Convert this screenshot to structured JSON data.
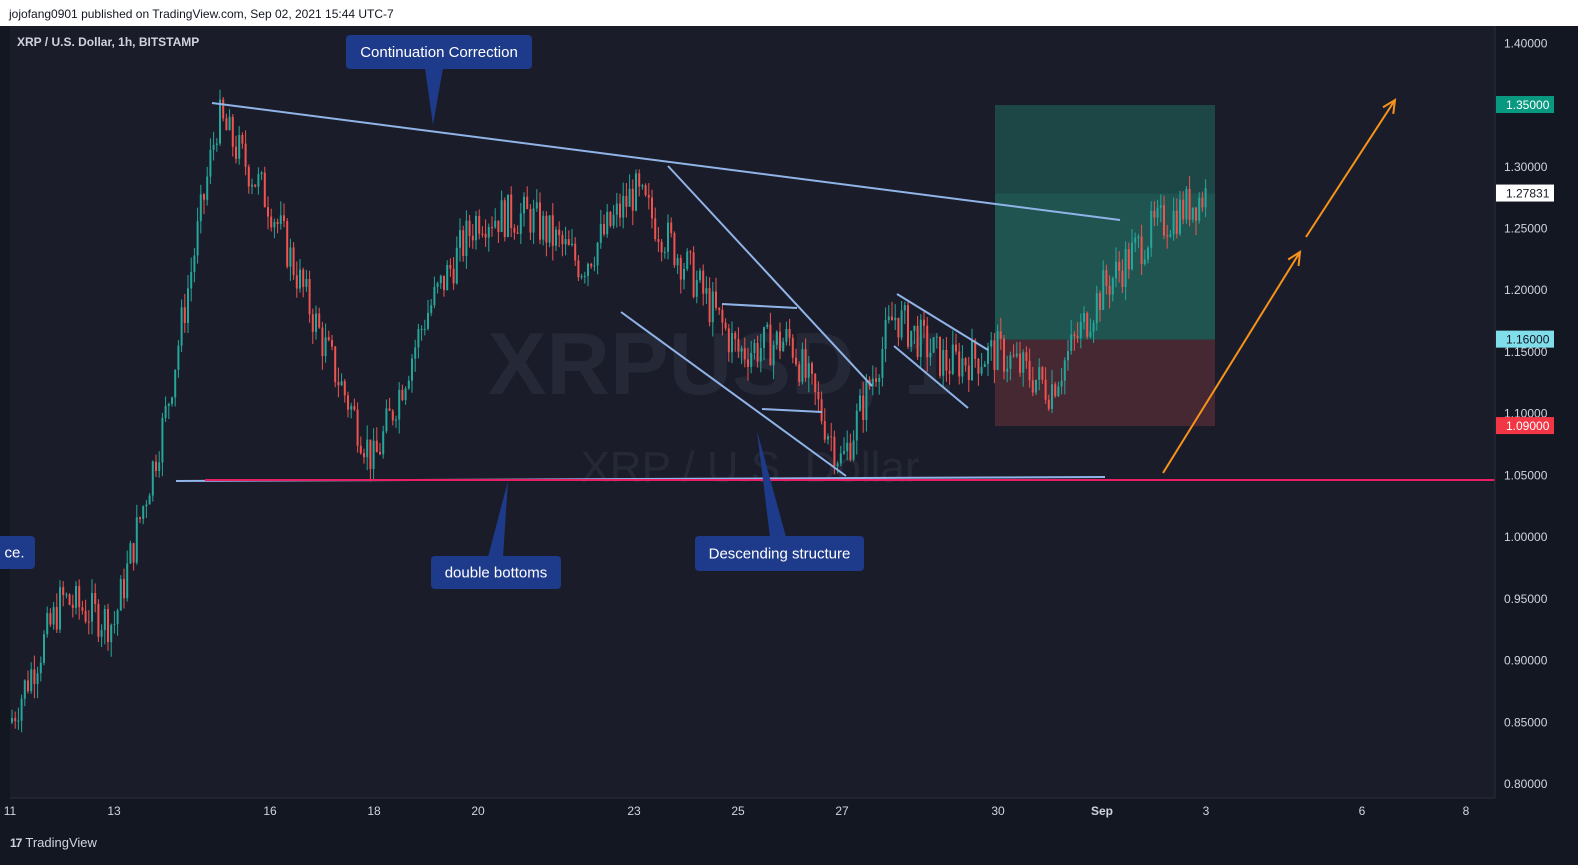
{
  "header": {
    "publisher": "jojofang0901 published on TradingView.com, Sep 02, 2021 15:44 UTC-7"
  },
  "symbol_title": "XRP / U.S. Dollar, 1h, BITSTAMP",
  "watermark": {
    "ticker": "XRPUSD, 1",
    "name": "XRP / U.S. Dollar"
  },
  "footer": {
    "brand": "TradingView",
    "logo_icon": "tradingview-logo-icon"
  },
  "colors": {
    "background": "#131722",
    "pane": "#1b1e2b",
    "up": "#26a69a",
    "down": "#ef5350",
    "trendline": "#90b4e8",
    "support": "#e91e63",
    "arrow": "#f7931a",
    "note_bg": "#1e3a8a",
    "target_zone": "#1f4d4b",
    "stop_zone": "#4a2a33"
  },
  "annotations": [
    {
      "id": "continuation-correction",
      "text": "Continuation Correction"
    },
    {
      "id": "double-bottoms",
      "text": "double bottoms"
    },
    {
      "id": "descending-structure",
      "text": "Descending structure"
    },
    {
      "id": "cut-note",
      "text": "ce."
    }
  ],
  "price_badges": [
    {
      "id": "target",
      "text": "1.35000",
      "bg": "#089981",
      "fg": "#ffffff"
    },
    {
      "id": "last",
      "text": "1.27831",
      "bg": "#ffffff",
      "fg": "#131722"
    },
    {
      "id": "entry",
      "text": "1.16000",
      "bg": "#80deea",
      "fg": "#131722"
    },
    {
      "id": "stop",
      "text": "1.09000",
      "bg": "#f23645",
      "fg": "#ffffff"
    }
  ],
  "chart_data": {
    "type": "candlestick",
    "title": "XRP / U.S. Dollar, 1h, BITSTAMP",
    "ylim": [
      0.8,
      1.4
    ],
    "yticks": [
      "1.40000",
      "1.35000",
      "1.30000",
      "1.25000",
      "1.20000",
      "1.15000",
      "1.10000",
      "1.05000",
      "1.00000",
      "0.95000",
      "0.90000",
      "0.85000",
      "0.80000"
    ],
    "xticks": [
      "11",
      "13",
      "16",
      "18",
      "20",
      "23",
      "25",
      "27",
      "30",
      "Sep",
      "3",
      "6",
      "8"
    ],
    "support_level": 1.05,
    "position": {
      "target": 1.35,
      "entry": 1.16,
      "stop": 1.09
    },
    "last_price": 1.27831,
    "price_path": [
      {
        "x": "11",
        "y": 0.85
      },
      {
        "x": "12",
        "y": 0.95
      },
      {
        "x": "13",
        "y": 0.93
      },
      {
        "x": "14",
        "y": 1.1
      },
      {
        "x": "15",
        "y": 1.34
      },
      {
        "x": "16",
        "y": 1.27
      },
      {
        "x": "17",
        "y": 1.16
      },
      {
        "x": "18",
        "y": 1.06
      },
      {
        "x": "19",
        "y": 1.18
      },
      {
        "x": "20",
        "y": 1.26
      },
      {
        "x": "21",
        "y": 1.26
      },
      {
        "x": "22",
        "y": 1.22
      },
      {
        "x": "23",
        "y": 1.28
      },
      {
        "x": "24",
        "y": 1.22
      },
      {
        "x": "25",
        "y": 1.15
      },
      {
        "x": "26",
        "y": 1.16
      },
      {
        "x": "27",
        "y": 1.06
      },
      {
        "x": "28",
        "y": 1.18
      },
      {
        "x": "29",
        "y": 1.14
      },
      {
        "x": "30",
        "y": 1.15
      },
      {
        "x": "31",
        "y": 1.12
      },
      {
        "x": "Sep",
        "y": 1.2
      },
      {
        "x": "2",
        "y": 1.25
      },
      {
        "x": "3",
        "y": 1.278
      }
    ]
  }
}
